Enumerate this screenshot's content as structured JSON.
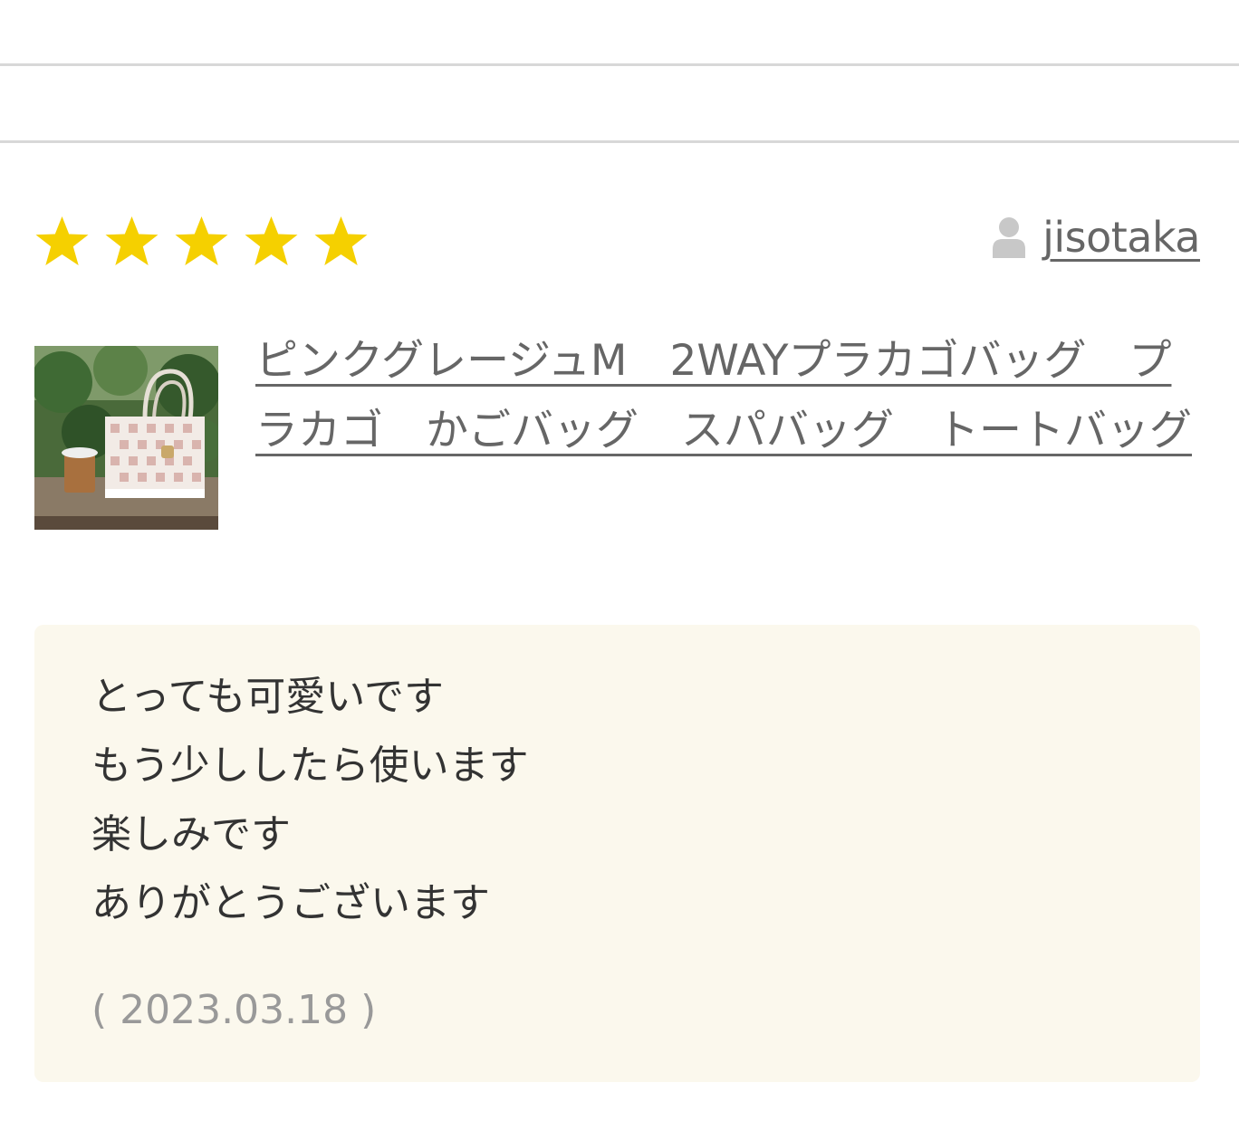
{
  "review": {
    "rating": 5,
    "rating_max": 5,
    "star_color": "#f5d000",
    "reviewer_icon": "person-icon",
    "reviewer_name": "jisotaka",
    "product_title": "ピンクグレージュM　2WAYプラカゴバッグ　プラカゴ　かごバッグ　スパバッグ　トートバッグ",
    "comment_lines": [
      "とっても可愛いです",
      "もう少ししたら使います",
      "楽しみです",
      "ありがとうございます"
    ],
    "date": "( 2023.03.18 )"
  },
  "colors": {
    "comment_background": "#fbf8ed",
    "link_text": "#666666",
    "date_text": "#999999"
  }
}
